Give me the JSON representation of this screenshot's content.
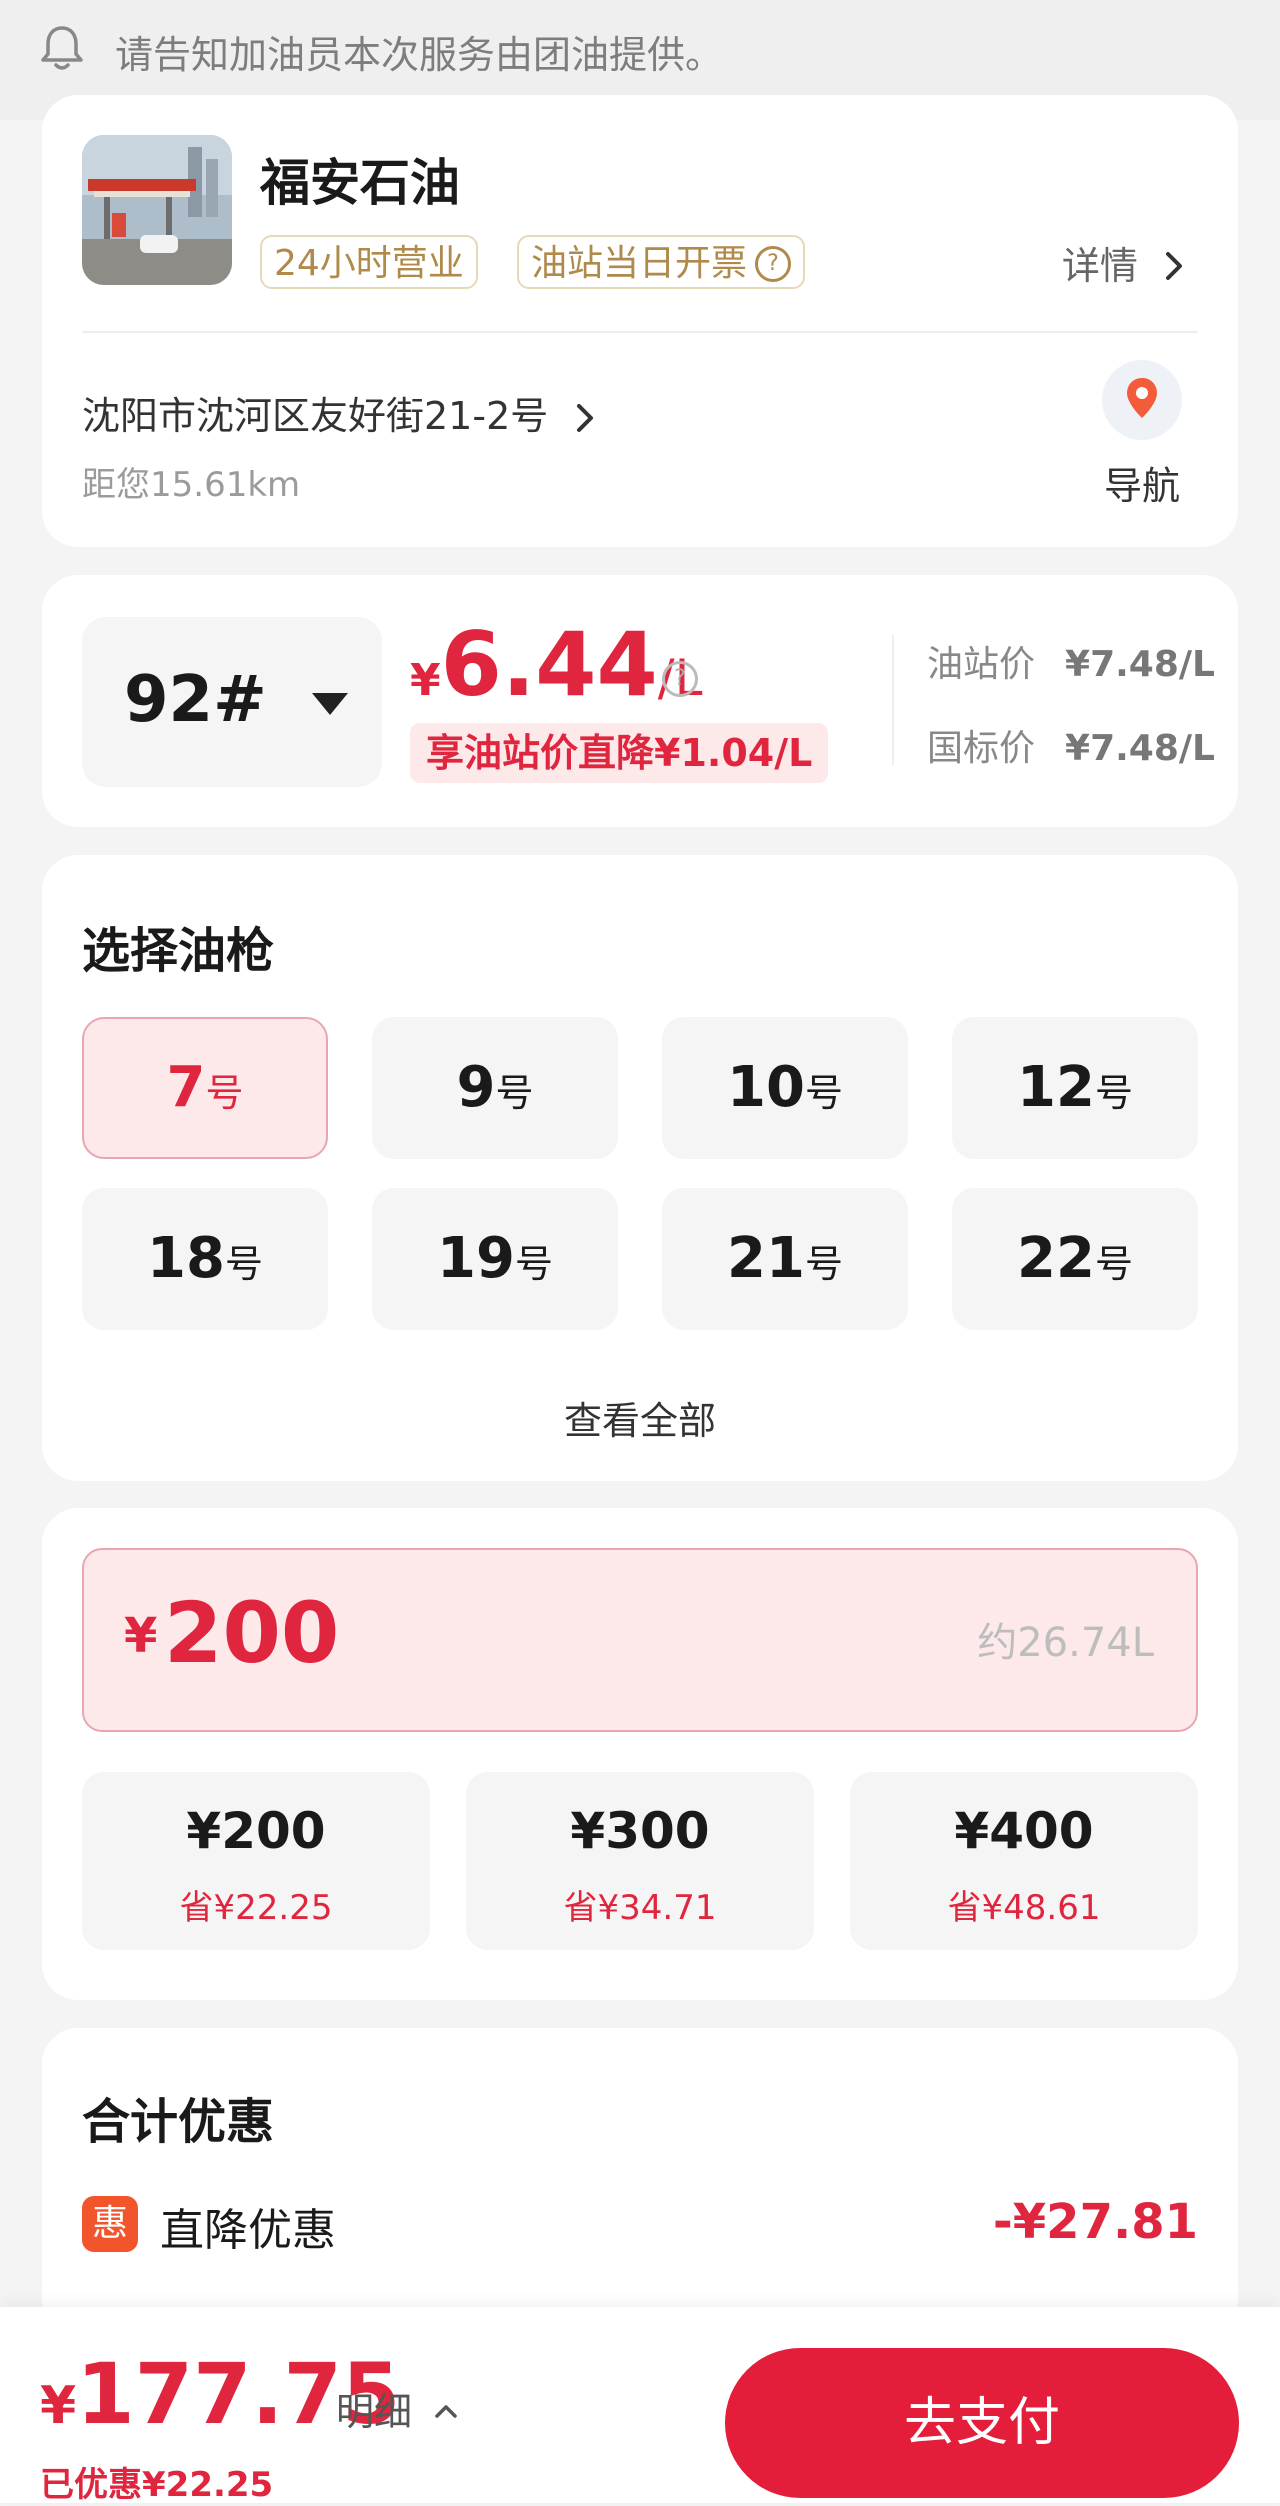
{
  "notice": {
    "text": "请告知加油员本次服务由团油提供。"
  },
  "station": {
    "name": "福安石油",
    "tags": [
      "24小时营业",
      "油站当日开票"
    ],
    "details_label": "详情",
    "address": "沈阳市沈河区友好街21-2号",
    "distance": "距您15.61km",
    "nav_label": "导航"
  },
  "price": {
    "fuel_grade": "92#",
    "currency": "¥",
    "value": "6.44",
    "unit": "/L",
    "discount_text": "享油站价直降¥1.04/L",
    "station_price_label": "油站价",
    "station_price": "¥7.48/L",
    "national_price_label": "国标价",
    "national_price": "¥7.48/L"
  },
  "guns": {
    "title": "选择油枪",
    "suffix": "号",
    "items": [
      {
        "number": "7",
        "selected": true
      },
      {
        "number": "9"
      },
      {
        "number": "10"
      },
      {
        "number": "12"
      },
      {
        "number": "18"
      },
      {
        "number": "19"
      },
      {
        "number": "21"
      },
      {
        "number": "22"
      }
    ],
    "view_all": "查看全部"
  },
  "amount": {
    "currency": "¥",
    "value": "200",
    "liters": "约26.74L",
    "presets": [
      {
        "amount": "¥200",
        "save": "省¥22.25"
      },
      {
        "amount": "¥300",
        "save": "省¥34.71"
      },
      {
        "amount": "¥400",
        "save": "省¥48.61"
      }
    ]
  },
  "savings": {
    "title": "合计优惠",
    "badge": "惠",
    "direct_label": "直降优惠",
    "direct_value": "-¥27.81"
  },
  "footer": {
    "currency": "¥",
    "total": "177.75",
    "detail_label": "明细",
    "saved": "已优惠¥22.25",
    "pay_label": "去支付"
  },
  "colors": {
    "accent": "#e0263e",
    "pay_button": "#e41e3a",
    "tag_gold": "#b08a4a"
  }
}
